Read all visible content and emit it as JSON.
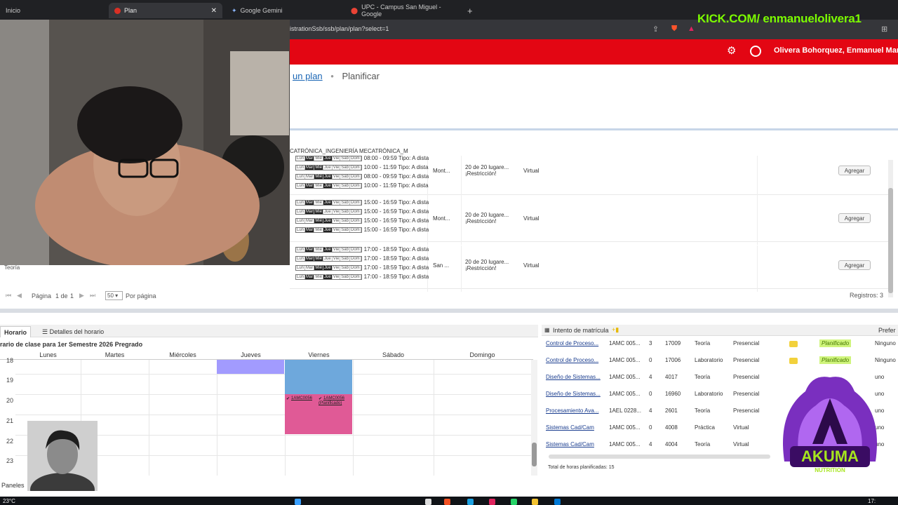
{
  "browser": {
    "tabs": [
      {
        "title": "Inicio",
        "color": "#5f6368"
      },
      {
        "title": "Plan",
        "color": "#d93025"
      },
      {
        "title": "Google Gemini",
        "color": "#8ab4f8"
      },
      {
        "title": "UPC - Campus San Miguel - Google",
        "color": "#ea4335"
      }
    ],
    "url": "istrationSsb/ssb/plan/plan?select=1"
  },
  "overlay": {
    "kick": "KICK.COM/ enmanuelolivera1"
  },
  "header": {
    "user_name": "Olivera Bohorquez, Enmanuel Mar",
    "brand_color": "#e30613"
  },
  "breadcrumb": {
    "link": "un plan",
    "separator": "•",
    "current": "Planificar"
  },
  "programa": "CATRÓNICA_INGENIERÍA MECATRÓNICA_M",
  "sections": [
    {
      "slots": [
        "08:00 - 09:59 Tipo: A dista",
        "10:00 - 11:59 Tipo: A dista",
        "08:00 - 09:59 Tipo: A dista",
        "10:00 - 11:59 Tipo: A dista"
      ],
      "campus": "Mont...",
      "seats": "20 de 20 lugare...",
      "restriction": "¡Restricción!",
      "modality": "Virtual",
      "action": "Agregar"
    },
    {
      "slots": [
        "15:00 - 16:59 Tipo: A dista",
        "15:00 - 16:59 Tipo: A dista",
        "15:00 - 16:59 Tipo: A dista",
        "15:00 - 16:59 Tipo: A dista"
      ],
      "campus": "Mont...",
      "seats": "20 de 20 lugare...",
      "restriction": "¡Restricción!",
      "modality": "Virtual",
      "action": "Agregar"
    },
    {
      "slots": [
        "17:00 - 18:59 Tipo: A dista",
        "17:00 - 18:59 Tipo: A dista",
        "17:00 - 18:59 Tipo: A dista",
        "17:00 - 18:59 Tipo: A dista"
      ],
      "campus": "San ...",
      "seats": "20 de 20 lugare...",
      "restriction": "¡Restricción!",
      "modality": "Virtual",
      "action": "Agregar"
    }
  ],
  "day_letters": [
    "Lun",
    "Mar",
    "Mié",
    "Jue",
    "Vie",
    "Sáb",
    "Dom"
  ],
  "partial_row_label": "Teoría",
  "pager": {
    "page_label": "Página",
    "page_of": "1 de",
    "page_total": "1",
    "per_page_value": "50",
    "per_page_label": "Por página",
    "records": "Registros: 3"
  },
  "schedule": {
    "tab_horario": "Horario",
    "tab_detalles": "Detalles del horario",
    "title": "rario de clase para 1er Semestre 2026 Pregrado",
    "days": [
      "Lunes",
      "Martes",
      "Miércoles",
      "Jueves",
      "Viernes",
      "Sábado",
      "Domingo"
    ],
    "hours": [
      "18",
      "19",
      "20",
      "21",
      "22",
      "23"
    ],
    "event_label_1": "1AMC0056",
    "event_label_2": "1AMC0056",
    "event_status": "(Planificado)",
    "colors": {
      "jueves": "#a29bfe",
      "viernes_top": "#6ea8dc",
      "viernes_bottom": "#e05a96"
    }
  },
  "panels_label": "Paneles",
  "intentos": {
    "header": "Intento de matrícula",
    "right_header": "Prefer",
    "rows": [
      {
        "curso": "Control de Proceso...",
        "codigo": "1AMC 005...",
        "creditos": "3",
        "crn": "17009",
        "tipo": "Teoría",
        "modalidad": "Presencial",
        "estado": "Planificado",
        "extra": "Ninguno"
      },
      {
        "curso": "Control de Proceso...",
        "codigo": "1AMC 005...",
        "creditos": "0",
        "crn": "17006",
        "tipo": "Laboratorio",
        "modalidad": "Presencial",
        "estado": "Planificado",
        "extra": "Ninguno"
      },
      {
        "curso": "Diseño de Sistemas...",
        "codigo": "1AMC 005...",
        "creditos": "4",
        "crn": "4017",
        "tipo": "Teoría",
        "modalidad": "Presencial",
        "estado": "",
        "extra": "uno"
      },
      {
        "curso": "Diseño de Sistemas...",
        "codigo": "1AMC 005...",
        "creditos": "0",
        "crn": "16960",
        "tipo": "Laboratorio",
        "modalidad": "Presencial",
        "estado": "",
        "extra": "uno"
      },
      {
        "curso": "Procesamiento Ava...",
        "codigo": "1AEL 0228...",
        "creditos": "4",
        "crn": "2601",
        "tipo": "Teoría",
        "modalidad": "Presencial",
        "estado": "",
        "extra": "uno"
      },
      {
        "curso": "Sistemas Cad/Cam",
        "codigo": "1AMC 005...",
        "creditos": "0",
        "crn": "4008",
        "tipo": "Práctica",
        "modalidad": "Virtual",
        "estado": "",
        "extra": "uno"
      },
      {
        "curso": "Sistemas Cad/Cam",
        "codigo": "1AMC 005...",
        "creditos": "4",
        "crn": "4004",
        "tipo": "Teoría",
        "modalidad": "Virtual",
        "estado": "",
        "extra": "uno"
      }
    ],
    "total": "Total de horas planificadas: 15"
  },
  "logo_text": {
    "brand": "AKUMA",
    "sub": "NUTRITION"
  },
  "taskbar": {
    "temp": "23°C",
    "clock": "17:"
  }
}
